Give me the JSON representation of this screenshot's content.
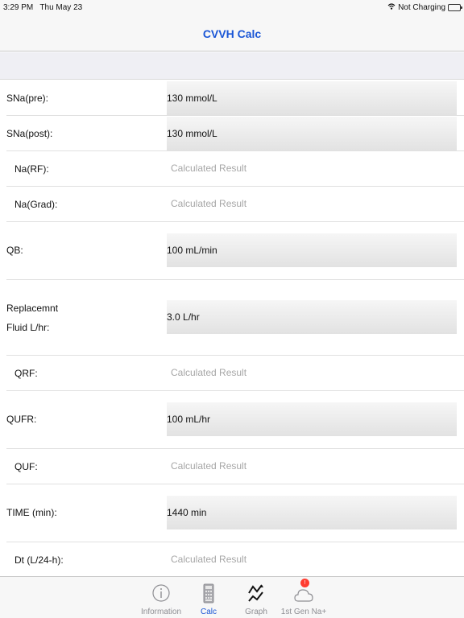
{
  "status_bar": {
    "time": "3:29 PM",
    "date": "Thu May 23",
    "charging": "Not Charging"
  },
  "nav": {
    "title": "CVVH Calc"
  },
  "rows": [
    {
      "label": "SNa(pre):",
      "value": "130 mmol/L"
    },
    {
      "label": "SNa(post):",
      "value": "130 mmol/L"
    },
    {
      "label": "Na(RF):",
      "placeholder": "Calculated Result"
    },
    {
      "label": "Na(Grad):",
      "placeholder": "Calculated Result"
    },
    {
      "label": "QB:",
      "value": "100 mL/min"
    },
    {
      "label_line1": "Replacemnt",
      "label_line2": "Fluid L/hr:",
      "value": "3.0 L/hr"
    },
    {
      "label": "QRF:",
      "placeholder": "Calculated Result"
    },
    {
      "label": "QUFR:",
      "value": "100 mL/hr"
    },
    {
      "label": "QUF:",
      "placeholder": "Calculated Result"
    },
    {
      "label": "TIME (min):",
      "value": "1440 min"
    },
    {
      "label": "Dt (L/24-h):",
      "placeholder": "Calculated Result"
    }
  ],
  "tabs": [
    {
      "label": "Information",
      "icon": "info-icon",
      "active": false
    },
    {
      "label": "Calc",
      "icon": "calculator-icon",
      "active": true
    },
    {
      "label": "Graph",
      "icon": "graph-icon",
      "active": false
    },
    {
      "label": "1st Gen Na+",
      "icon": "cloud-icon",
      "active": false,
      "badge": "!"
    }
  ],
  "colors": {
    "accent": "#1a56d6",
    "badge": "#ff3b30",
    "placeholder": "#a6a6a6"
  }
}
